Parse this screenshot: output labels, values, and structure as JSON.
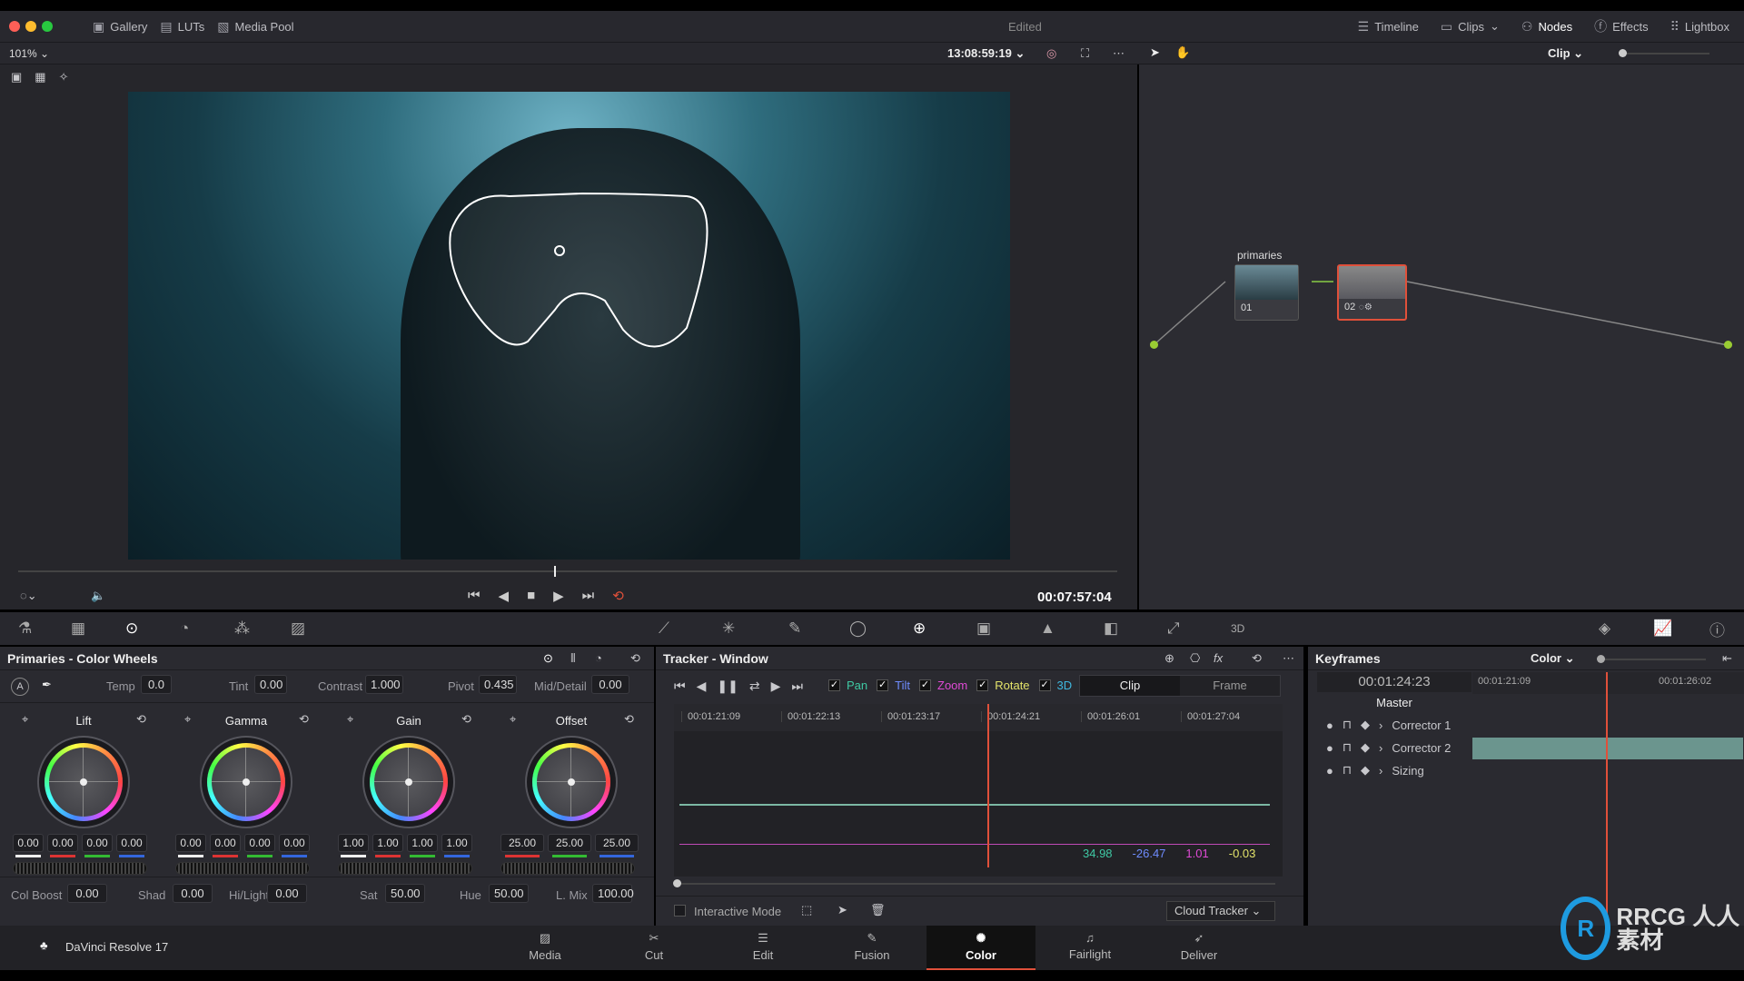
{
  "topbar": {
    "items": [
      {
        "label": "Gallery",
        "icon": "gallery-icon"
      },
      {
        "label": "LUTs",
        "icon": "luts-icon"
      },
      {
        "label": "Media Pool",
        "icon": "media-pool-icon"
      }
    ],
    "status": "Edited",
    "right": [
      {
        "label": "Timeline",
        "icon": "timeline-icon"
      },
      {
        "label": "Clips",
        "icon": "clips-icon"
      },
      {
        "label": "Nodes",
        "icon": "nodes-icon"
      },
      {
        "label": "Effects",
        "icon": "effects-icon"
      },
      {
        "label": "Lightbox",
        "icon": "lightbox-icon"
      }
    ]
  },
  "viewer": {
    "zoom": "101%",
    "timecode": "13:08:59:19",
    "clip_mode": "Clip",
    "playhead_timecode": "00:07:57:04"
  },
  "nodes": [
    {
      "label": "primaries",
      "number": "01"
    },
    {
      "label": "",
      "number": "02"
    }
  ],
  "primaries": {
    "title": "Primaries - Color Wheels",
    "top": [
      {
        "label": "Temp",
        "value": "0.0"
      },
      {
        "label": "Tint",
        "value": "0.00"
      },
      {
        "label": "Contrast",
        "value": "1.000"
      },
      {
        "label": "Pivot",
        "value": "0.435"
      },
      {
        "label": "Mid/Detail",
        "value": "0.00"
      }
    ],
    "wheels": [
      {
        "name": "Lift",
        "values": [
          "0.00",
          "0.00",
          "0.00",
          "0.00"
        ]
      },
      {
        "name": "Gamma",
        "values": [
          "0.00",
          "0.00",
          "0.00",
          "0.00"
        ]
      },
      {
        "name": "Gain",
        "values": [
          "1.00",
          "1.00",
          "1.00",
          "1.00"
        ]
      },
      {
        "name": "Offset",
        "values": [
          "25.00",
          "25.00",
          "25.00"
        ]
      }
    ],
    "bottom": [
      {
        "label": "Col Boost",
        "value": "0.00"
      },
      {
        "label": "Shad",
        "value": "0.00"
      },
      {
        "label": "Hi/Light",
        "value": "0.00"
      },
      {
        "label": "Sat",
        "value": "50.00"
      },
      {
        "label": "Hue",
        "value": "50.00"
      },
      {
        "label": "L. Mix",
        "value": "100.00"
      }
    ]
  },
  "tracker": {
    "title": "Tracker - Window",
    "checks": [
      {
        "label": "Pan",
        "color": "#3fc9a4"
      },
      {
        "label": "Tilt",
        "color": "#6f8cff"
      },
      {
        "label": "Zoom",
        "color": "#e04ad6"
      },
      {
        "label": "Rotate",
        "color": "#e3e36a"
      },
      {
        "label": "3D",
        "color": "#3fb8e0"
      }
    ],
    "modes": [
      "Clip",
      "Frame"
    ],
    "ticks": [
      "00:01:21:09",
      "00:01:22:13",
      "00:01:23:17",
      "00:01:24:21",
      "00:01:26:01",
      "00:01:27:04"
    ],
    "readouts": [
      {
        "value": "34.98",
        "color": "#3fc9a4"
      },
      {
        "value": "-26.47",
        "color": "#6f8cff"
      },
      {
        "value": "1.01",
        "color": "#e04ad6"
      },
      {
        "value": "-0.03",
        "color": "#e3e36a"
      }
    ],
    "interactive_mode": "Interactive Mode",
    "tracker_type": "Cloud Tracker"
  },
  "keyframes": {
    "title": "Keyframes",
    "filter": "Color",
    "timecode": "00:01:24:23",
    "ticks": [
      "00:01:21:09",
      "00:01:26:02"
    ],
    "master": "Master",
    "rows": [
      "Corrector 1",
      "Corrector 2",
      "Sizing"
    ]
  },
  "app": {
    "name": "DaVinci Resolve 17"
  },
  "nav": [
    {
      "label": "Media",
      "icon": "media-icon"
    },
    {
      "label": "Cut",
      "icon": "cut-icon"
    },
    {
      "label": "Edit",
      "icon": "edit-icon"
    },
    {
      "label": "Fusion",
      "icon": "fusion-icon"
    },
    {
      "label": "Color",
      "icon": "color-icon",
      "active": true
    },
    {
      "label": "Fairlight",
      "icon": "fairlight-icon"
    },
    {
      "label": "Deliver",
      "icon": "deliver-icon"
    }
  ],
  "watermark": "RRCG 人人素材"
}
